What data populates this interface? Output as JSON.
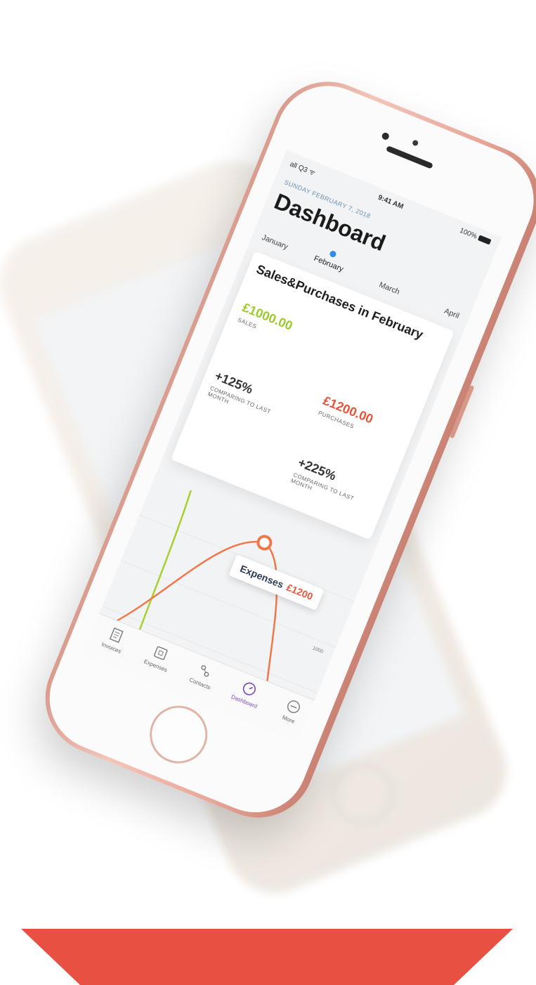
{
  "status": {
    "signal": "all Q3 ᯤ",
    "time": "9:41 AM",
    "battery": "100%"
  },
  "header": {
    "date": "SUNDAY FEBRUARY 7, 2018",
    "title": "Dashboard"
  },
  "tabs": [
    {
      "label": "January"
    },
    {
      "label": "February"
    },
    {
      "label": "March"
    },
    {
      "label": "April"
    }
  ],
  "card": {
    "title": "Sales&Purchases in February",
    "sales": {
      "value": "£1000.00",
      "label": "SALES"
    },
    "purchases": {
      "value": "£1200.00",
      "label": "PURCHASES"
    },
    "compare_sales": {
      "value": "+125%",
      "label": "COMPARING TO LAST MONTH"
    },
    "compare_purchases": {
      "value": "+225%",
      "label": "COMPARING TO LAST MONTH"
    }
  },
  "chart": {
    "tooltip_label": "Expenses",
    "tooltip_value": "£1200",
    "axis_labels": [
      "1000",
      "1000"
    ],
    "colors": {
      "expenses": "#f07848",
      "income": "#a9cf2e"
    }
  },
  "tabbar": [
    {
      "label": "Invoices",
      "icon": "invoice-icon"
    },
    {
      "label": "Expenses",
      "icon": "receipt-icon"
    },
    {
      "label": "Contacts",
      "icon": "contacts-icon"
    },
    {
      "label": "Dashboard",
      "icon": "dashboard-icon"
    },
    {
      "label": "More",
      "icon": "more-icon"
    }
  ],
  "colors": {
    "ribbon": "#e85041",
    "phone": "#e8a798",
    "accent": "#2f8de4"
  }
}
